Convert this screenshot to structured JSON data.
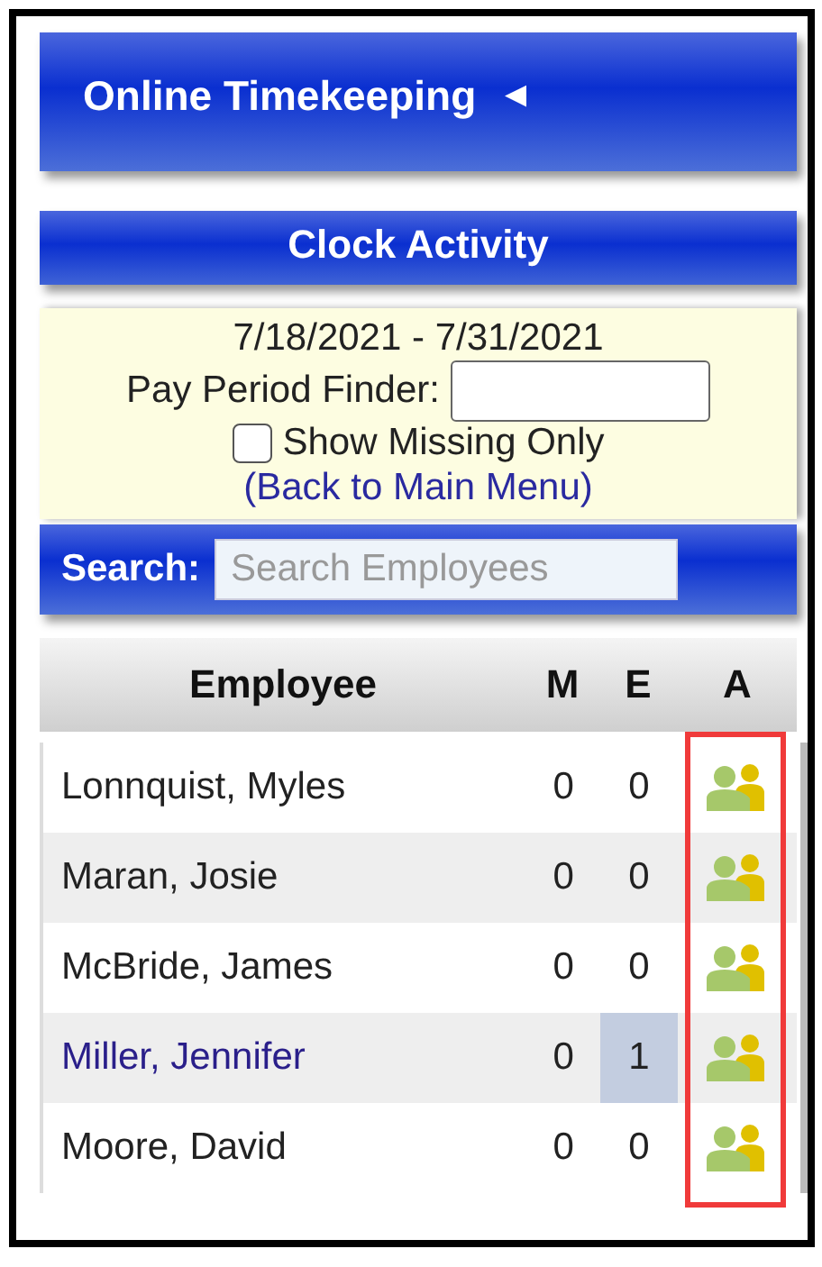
{
  "header": {
    "title": "Online Timekeeping",
    "toggle": "◄"
  },
  "section_title": "Clock Activity",
  "filter": {
    "date_range": "7/18/2021 - 7/31/2021",
    "finder_label": "Pay Period Finder:",
    "show_missing_label": "Show Missing Only",
    "show_missing_checked": false,
    "back_link": "(Back to Main Menu)"
  },
  "search": {
    "label": "Search:",
    "placeholder": "Search Employees"
  },
  "table": {
    "columns": [
      "Employee",
      "M",
      "E",
      "A"
    ],
    "column_a_outlined": true,
    "rows": [
      {
        "name": "Lonnquist, Myles",
        "m": "0",
        "e": "0",
        "selected": false,
        "e_flagged": false
      },
      {
        "name": "Maran, Josie",
        "m": "0",
        "e": "0",
        "selected": false,
        "e_flagged": false
      },
      {
        "name": "McBride, James",
        "m": "0",
        "e": "0",
        "selected": false,
        "e_flagged": false
      },
      {
        "name": "Miller, Jennifer",
        "m": "0",
        "e": "1",
        "selected": true,
        "e_flagged": true
      },
      {
        "name": "Moore, David",
        "m": "0",
        "e": "0",
        "selected": false,
        "e_flagged": false
      }
    ]
  }
}
